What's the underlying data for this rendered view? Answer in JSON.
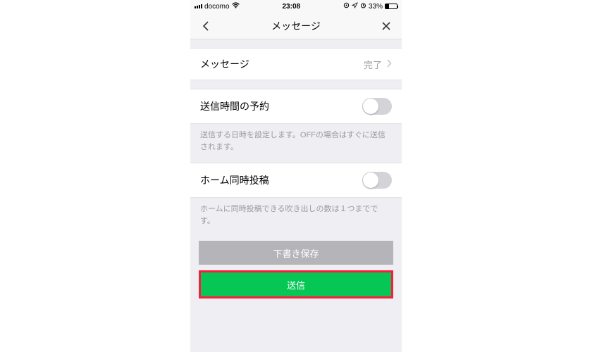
{
  "status": {
    "carrier": "docomo",
    "time": "23:08",
    "battery_pct": "33%"
  },
  "nav": {
    "title": "メッセージ"
  },
  "rows": {
    "message": {
      "label": "メッセージ",
      "status": "完了"
    },
    "schedule": {
      "label": "送信時間の予約"
    },
    "schedule_help": "送信する日時を設定します。OFFの場合はすぐに送信されます。",
    "home_post": {
      "label": "ホーム同時投稿"
    },
    "home_help": "ホームに同時投稿できる吹き出しの数は１つまでです。"
  },
  "buttons": {
    "save_draft": "下書き保存",
    "send": "送信"
  }
}
